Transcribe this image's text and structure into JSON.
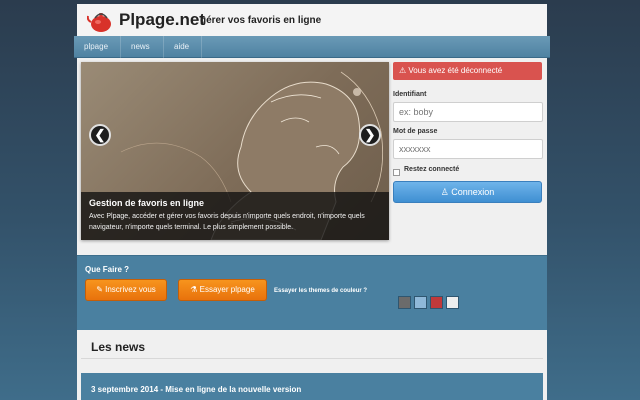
{
  "header": {
    "title": "Plpage.net",
    "tagline": "gérer vos favoris en ligne",
    "logo_icon": "teapot-icon"
  },
  "nav": {
    "items": [
      {
        "label": "plpage"
      },
      {
        "label": "news"
      },
      {
        "label": "aide"
      }
    ]
  },
  "carousel": {
    "prev_glyph": "❮",
    "next_glyph": "❯",
    "caption_title": "Gestion de favoris en ligne",
    "caption_text": "Avec Plpage, accéder et gérer vos favoris depuis n'importe quels endroit, n'importe quels navigateur, n'importe quels terminal. Le plus simplement possible."
  },
  "login": {
    "alert": "Vous avez été déconnecté",
    "alert_icon": "warning-icon",
    "username_label": "Identifiant",
    "username_placeholder": "ex: boby",
    "password_label": "Mot de passe",
    "password_placeholder": "xxxxxxx",
    "remember_label": "Restez connecté",
    "remember_checked": false,
    "submit_label": "Connexion",
    "submit_icon": "user-icon"
  },
  "actions": {
    "title": "Que Faire ?",
    "signup_label": "Inscrivez vous",
    "signup_icon": "signup-icon",
    "try_label": "Essayer plpage",
    "try_icon": "flask-icon",
    "themes_label": "Essayer les themes de couleur ?",
    "themes": [
      {
        "name": "theme-gray",
        "color": "#6b6b6b"
      },
      {
        "name": "theme-blue",
        "color": "#8fb8d8"
      },
      {
        "name": "theme-red",
        "color": "#c0393b"
      },
      {
        "name": "theme-light",
        "color": "#eeeeee"
      }
    ]
  },
  "news": {
    "title": "Les news",
    "items": [
      {
        "title": "3 septembre 2014 - Mise en ligne de la nouvelle version"
      }
    ]
  },
  "colors": {
    "accent_blue": "#4a80a0",
    "alert_red": "#d9534f",
    "orange": "#f7941d",
    "login_blue": "#3f8fd2"
  }
}
